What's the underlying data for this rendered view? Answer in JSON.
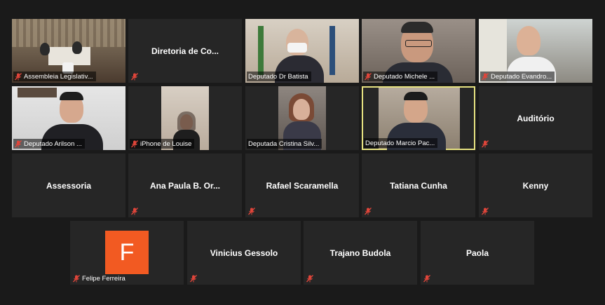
{
  "participants": [
    {
      "name": "Assembleia Legislativ...",
      "type": "video",
      "muted": true
    },
    {
      "name": "Diretoria de Co...",
      "type": "name",
      "muted": true
    },
    {
      "name": "Deputado Dr Batista",
      "type": "video",
      "muted": false
    },
    {
      "name": "Deputado Michele ...",
      "type": "video",
      "muted": true
    },
    {
      "name": "Deputado Evandro...",
      "type": "video",
      "muted": true
    },
    {
      "name": "Deputado Arilson ...",
      "type": "video",
      "muted": true
    },
    {
      "name": "iPhone de Louise",
      "type": "video",
      "muted": true
    },
    {
      "name": "Deputada Cristina Silv...",
      "type": "video",
      "muted": false
    },
    {
      "name": "Deputado Marcio Pac...",
      "type": "video",
      "muted": false,
      "active_speaker": true
    },
    {
      "name": "Auditório",
      "type": "name",
      "muted": true
    },
    {
      "name": "Assessoria",
      "type": "name",
      "muted": false
    },
    {
      "name": "Ana Paula B. Or...",
      "type": "name",
      "muted": true
    },
    {
      "name": "Rafael Scaramella",
      "type": "name",
      "muted": true
    },
    {
      "name": "Tatiana Cunha",
      "type": "name",
      "muted": true
    },
    {
      "name": "Kenny",
      "type": "name",
      "muted": true
    },
    {
      "name": "Felipe Ferreira",
      "type": "avatar",
      "initial": "F",
      "avatar_color": "#f25a22",
      "muted": true
    },
    {
      "name": "Vinicius Gessolo",
      "type": "name",
      "muted": true
    },
    {
      "name": "Trajano Budola",
      "type": "name",
      "muted": true
    },
    {
      "name": "Paola",
      "type": "name",
      "muted": true
    }
  ],
  "colors": {
    "background": "#1a1a1a",
    "tile": "#262626",
    "active_border": "#e6e281",
    "muted_icon": "#e0453a"
  }
}
